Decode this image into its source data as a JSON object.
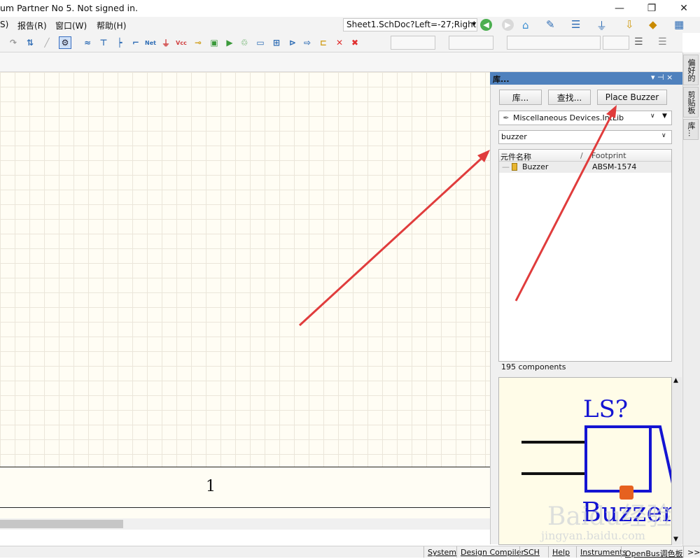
{
  "window": {
    "title": "um Partner No 5. Not signed in.",
    "minimize": "—",
    "restore": "❐",
    "close": "✕"
  },
  "menu": {
    "items": [
      "S)",
      "报告(R)",
      "窗口(W)",
      "帮助(H)"
    ]
  },
  "toolbar": {
    "sheet_location": "Sheet1.SchDoc?Left=-27;Right="
  },
  "canvas": {
    "zone_number": "1",
    "annotation_color": "#e03c3c"
  },
  "panel": {
    "title": "库...",
    "pin": "▾ ⊣ ×",
    "btn_libraries": "库...",
    "btn_search": "查找...",
    "btn_place": "Place Buzzer",
    "library_name": "Miscellaneous Devices.IntLib",
    "filter_value": "buzzer",
    "col_name": "元件名称",
    "col_sort": "/",
    "col_footprint": "Footprint",
    "rows": [
      {
        "name": "Buzzer",
        "footprint": "ABSM-1574"
      }
    ],
    "count": "195 components",
    "preview": {
      "designator": "LS?",
      "comment": "Buzzer",
      "symbol_color": "#1414d2"
    }
  },
  "sidebar": {
    "tabs": [
      "偏好的",
      "剪贴板",
      "库..."
    ]
  },
  "status": {
    "items": [
      "System",
      "Design Compiler",
      "SCH",
      "Help",
      "Instruments",
      "OpenBus调色板",
      ">>"
    ]
  },
  "watermark": {
    "brand": "Baidu经验",
    "url": "jingyan.baidu.com"
  }
}
